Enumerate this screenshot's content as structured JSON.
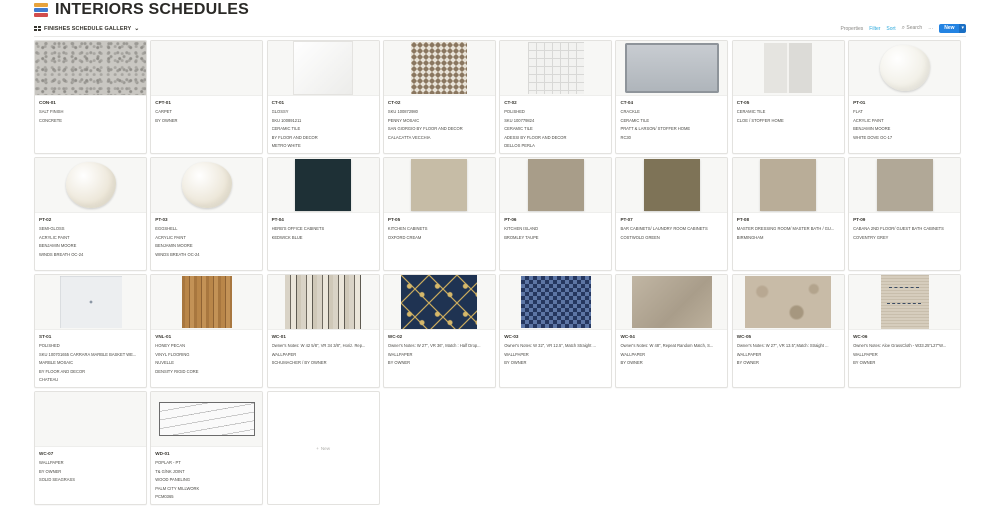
{
  "page": {
    "title": "INTERIORS SCHEDULES"
  },
  "view": {
    "label": "FINISHES SCHEDULE GALLERY"
  },
  "toolbar": {
    "properties": "Properties",
    "filter": "Filter",
    "sort": "Sort",
    "search": "Search",
    "more": "···",
    "new": "New"
  },
  "new_card": {
    "label": "New"
  },
  "cards": [
    {
      "code": "CON-01",
      "lines": [
        "SALT FINISH",
        "CONCRETE"
      ],
      "swatch": "speckle"
    },
    {
      "code": "CPT-01",
      "lines": [
        "CARPET",
        "BY OWNER"
      ],
      "swatch": "none"
    },
    {
      "code": "CT-01",
      "lines": [
        "GLOSSY",
        "SKU 100891211",
        "CERAMIC TILE",
        "BY FLOOR AND DECOR",
        "METRO WHITE"
      ],
      "swatch": "white"
    },
    {
      "code": "CT-02",
      "lines": [
        "SKU 100872980",
        "PENNY MOSAIC",
        "SAN GIORGIO BY FLOOR AND DECOR",
        "CALACATTA VECCHIA"
      ],
      "swatch": "penny"
    },
    {
      "code": "CT-02",
      "lines": [
        "POLISHED",
        "SKU 100779824",
        "CERAMIC TILE",
        "ADESSI BY FLOOR AND DECOR",
        "DELLOS PERLA"
      ],
      "swatch": "grid"
    },
    {
      "code": "CT-04",
      "lines": [
        "CRACKLE",
        "CERAMIC TILE",
        "PRATT & LARSON/ STOFFER HOME",
        "RC30"
      ],
      "swatch": "subway"
    },
    {
      "code": "CT-05",
      "lines": [
        "CERAMIC TILE",
        "CLOE / STOFFER HOME"
      ],
      "swatch": "cloe"
    },
    {
      "code": "PT-01",
      "lines": [
        "FLAT",
        "ACRYLIC PAINT",
        "BENJAMIN MOORE",
        "WHITE DOVE OC-17"
      ],
      "swatch": "paint",
      "color": "#f1efe6"
    },
    {
      "code": "PT-02",
      "lines": [
        "SEMI-GLOSS",
        "ACRYLIC PAINT",
        "BENJAMIN MOORE",
        "WINDS BREATH OC-24"
      ],
      "swatch": "paint",
      "color": "#ebe5d6"
    },
    {
      "code": "PT-03",
      "lines": [
        "EGGSHELL",
        "ACRYLIC PAINT",
        "BENJAMIN MOORE",
        "WINDS BREATH OC-24"
      ],
      "swatch": "paint",
      "color": "#ebe5d6"
    },
    {
      "code": "PT-04",
      "lines": [
        "HERB'S OFFICE CABINETS",
        "KEDWICK BLUE"
      ],
      "swatch": "square",
      "color": "#1e3036"
    },
    {
      "code": "PT-05",
      "lines": [
        "KITCHEN CABINETS",
        "OXFORD CREAM"
      ],
      "swatch": "square",
      "color": "#c6bca6"
    },
    {
      "code": "PT-06",
      "lines": [
        "KITCHEN ISLAND",
        "BROMLEY TAUPE"
      ],
      "swatch": "square",
      "color": "#a89d89"
    },
    {
      "code": "PT-07",
      "lines": [
        "BAR CABINETS/ LAUNDRY ROOM CABINETS",
        "COSTWOLD GREEN"
      ],
      "swatch": "square",
      "color": "#7e7357"
    },
    {
      "code": "PT-08",
      "lines": [
        "MASTER DRESSING ROOM/ MASTER BATH / GU...",
        "BIRMINGHAM"
      ],
      "swatch": "square",
      "color": "#b9ad98"
    },
    {
      "code": "PT-09",
      "lines": [
        "CABANA 2ND FLOOR/ GUEST BATH CABINETS",
        "COVENTRY GREY"
      ],
      "swatch": "square",
      "color": "#b1a897"
    },
    {
      "code": "ST-01",
      "lines": [
        "POLISHED",
        "SKU 100701655 CARRARA MARBLE BASKET WE...",
        "MARBLE MOSAIC",
        "BY FLOOR AND DECOR",
        "CHATEAU"
      ],
      "swatch": "basket"
    },
    {
      "code": "VNL-01",
      "lines": [
        "HONEY PECAN",
        "VINYL FLOORING",
        "NUVELLE",
        "DENSITY RIGID CORE"
      ],
      "swatch": "wood"
    },
    {
      "code": "WC-01",
      "lines": [
        "Owner's Notes: W 42 5/8\", VR 34 3/8\", Horiz. Rep...",
        "WALLPAPER",
        "SCHUMACHER / BY OWNER"
      ],
      "swatch": "stripe"
    },
    {
      "code": "WC-02",
      "lines": [
        "Owner's Notes: W 27\", VR 36\", Match : Half Drop...",
        "WALLPAPER",
        "BY OWNER"
      ],
      "swatch": "navystar"
    },
    {
      "code": "WC-03",
      "lines": [
        "Owner's Notes: W 32\", VR 12.5\", Match Straight ...",
        "WALLPAPER",
        "BY OWNER"
      ],
      "swatch": "diamond"
    },
    {
      "code": "WC-04",
      "lines": [
        "Owner's Notes: W 48\", Repeat Random Match, S...",
        "WALLPAPER",
        "BY OWNER"
      ],
      "swatch": "beige"
    },
    {
      "code": "WC-05",
      "lines": [
        "Owner's Notes: W 27\", VR 13.5\",Match: Straight ...",
        "WALLPAPER",
        "BY OWNER"
      ],
      "swatch": "mottle"
    },
    {
      "code": "WC-06",
      "lines": [
        "Owner's Notes: Aloe GrassCloth - W33.25\"L27\"W...",
        "WALLPAPER",
        "BY OWNER"
      ],
      "swatch": "wave"
    },
    {
      "code": "WC-07",
      "lines": [
        "WALLPAPER",
        "BY OWNER",
        "SOLID SEAGRASS"
      ],
      "swatch": "none"
    },
    {
      "code": "WD-01",
      "lines": [
        "POPLAR - PT",
        "T& G/NK JOINT",
        "WOOD PANELING",
        "PALM CITY MILLWORK",
        "PCM0365"
      ],
      "swatch": "plank"
    }
  ]
}
